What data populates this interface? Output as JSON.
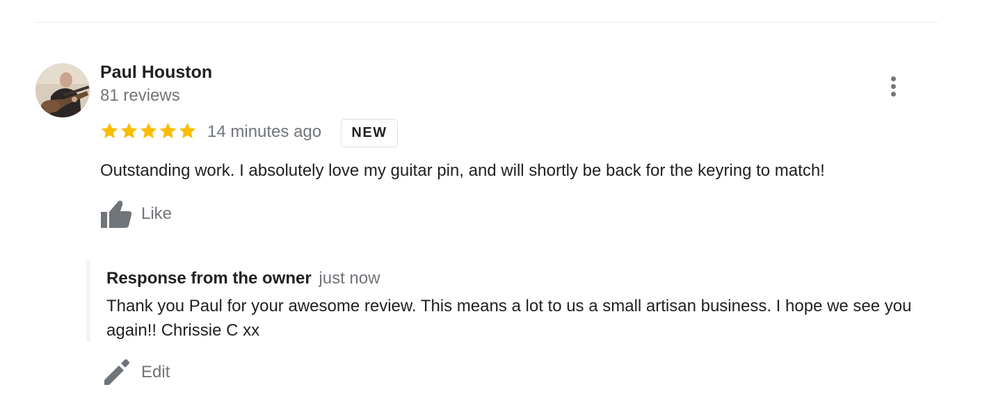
{
  "review": {
    "reviewer_name": "Paul Houston",
    "review_count": "81 reviews",
    "rating": 5,
    "rating_max": 5,
    "time": "14 minutes ago",
    "badge": "NEW",
    "text": "Outstanding work. I absolutely love my guitar pin, and will shortly be back for the keyring to match!",
    "like_label": "Like",
    "avatar_icon": "reviewer-avatar",
    "more_icon": "more-vert-icon",
    "like_icon": "thumbs-up-icon"
  },
  "response": {
    "title": "Response from the owner",
    "time": "just now",
    "text": "Thank you Paul for your awesome review. This means a lot to us a small artisan business. I hope we see you again!! Chrissie C xx",
    "edit_label": "Edit",
    "edit_icon": "pencil-icon"
  },
  "colors": {
    "star": "#fbbc04",
    "secondary_text": "#70757a",
    "icon_gray": "#70757a",
    "divider": "#ebebeb",
    "response_border": "#f1f3f4"
  }
}
